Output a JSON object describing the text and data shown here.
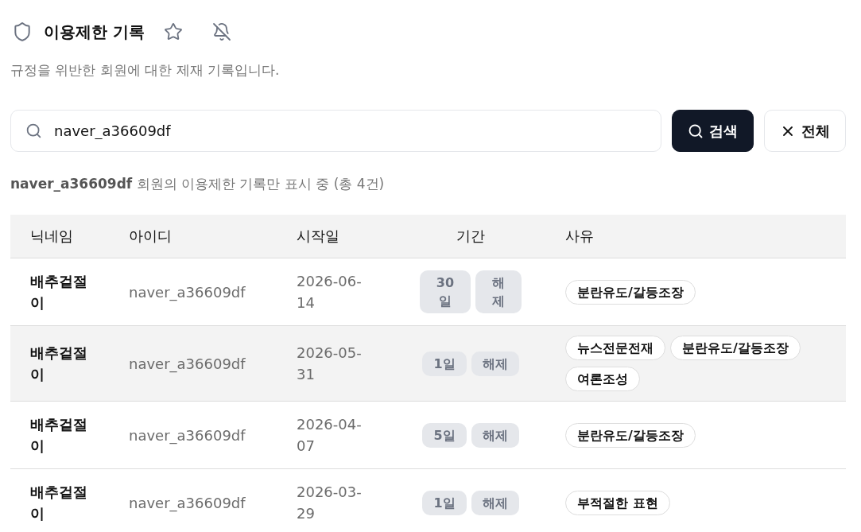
{
  "header": {
    "title": "이용제한 기록",
    "favorite": false,
    "notifications": false,
    "description": "규정을 위반한 회원에 대한 제재 기록입니다."
  },
  "search": {
    "value": "naver_a36609df",
    "search_button": "검색",
    "clear_button": "전체"
  },
  "filter_note": "**naver_a36609df** 회원의 이용제한 기록만 표시 중 (총 4건)",
  "table": {
    "columns": [
      "닉네임",
      "아이디",
      "시작일",
      "기간",
      "사유"
    ],
    "rows": [
      {
        "nickname": "배추겉절이",
        "user_id": "naver_a36609df",
        "start_date": "2026-06-14",
        "duration": "30일",
        "status": "해제",
        "reasons": [
          "분란유도/갈등조장"
        ],
        "highlighted": false
      },
      {
        "nickname": "배추겉절이",
        "user_id": "naver_a36609df",
        "start_date": "2026-05-31",
        "duration": "1일",
        "status": "해제",
        "reasons": [
          "뉴스전문전재",
          "분란유도/갈등조장",
          "여론조성"
        ],
        "highlighted": true
      },
      {
        "nickname": "배추겉절이",
        "user_id": "naver_a36609df",
        "start_date": "2026-04-07",
        "duration": "5일",
        "status": "해제",
        "reasons": [
          "분란유도/갈등조장"
        ],
        "highlighted": false
      },
      {
        "nickname": "배추겉절이",
        "user_id": "naver_a36609df",
        "start_date": "2026-03-29",
        "duration": "1일",
        "status": "해제",
        "reasons": [
          "부적절한 표현"
        ],
        "highlighted": false
      }
    ]
  }
}
